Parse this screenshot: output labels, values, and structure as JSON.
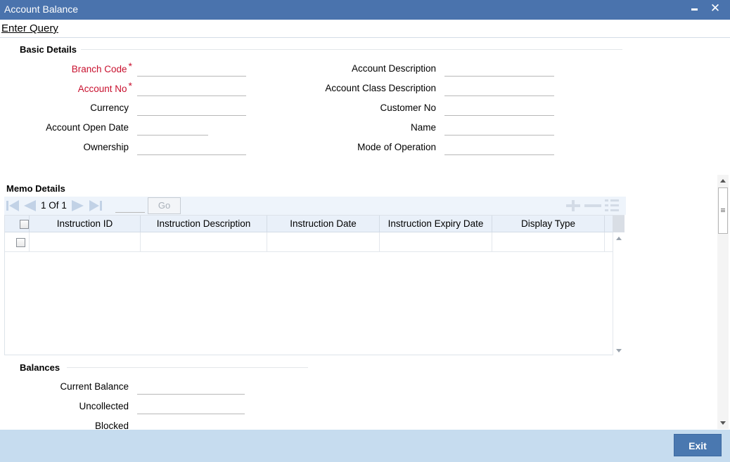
{
  "window": {
    "title": "Account Balance",
    "minimize_label": "_",
    "close_label": "✕"
  },
  "menu": {
    "enter_query": "Enter Query"
  },
  "basic_details": {
    "title": "Basic Details",
    "branch_code": {
      "label": "Branch Code",
      "required": "*",
      "value": ""
    },
    "account_no": {
      "label": "Account No",
      "required": "*",
      "value": ""
    },
    "currency": {
      "label": "Currency",
      "value": ""
    },
    "account_open_date": {
      "label": "Account Open Date",
      "value": ""
    },
    "ownership": {
      "label": "Ownership",
      "value": ""
    },
    "account_description": {
      "label": "Account Description",
      "value": ""
    },
    "account_class_description": {
      "label": "Account Class Description",
      "value": ""
    },
    "customer_no": {
      "label": "Customer No",
      "value": ""
    },
    "name": {
      "label": "Name",
      "value": ""
    },
    "mode_of_operation": {
      "label": "Mode of Operation",
      "value": ""
    }
  },
  "memo_details": {
    "title": "Memo Details",
    "pager": {
      "current": "1",
      "of_label": "Of",
      "total": "1",
      "go_label": "Go"
    },
    "columns": [
      "Instruction ID",
      "Instruction Description",
      "Instruction Date",
      "Instruction Expiry Date",
      "Display Type"
    ],
    "rows": [
      {
        "instruction_id": "",
        "instruction_description": "",
        "instruction_date": "",
        "instruction_expiry_date": "",
        "display_type": ""
      }
    ]
  },
  "balances": {
    "title": "Balances",
    "current_balance": {
      "label": "Current Balance",
      "value": ""
    },
    "uncollected": {
      "label": "Uncollected",
      "value": ""
    },
    "blocked": {
      "label": "Blocked",
      "value": ""
    }
  },
  "footer": {
    "exit_label": "Exit"
  },
  "colors": {
    "titlebar": "#4a73ad",
    "required": "#c8102e",
    "footer": "#c6dcef",
    "exit_button": "#4a78b0"
  }
}
